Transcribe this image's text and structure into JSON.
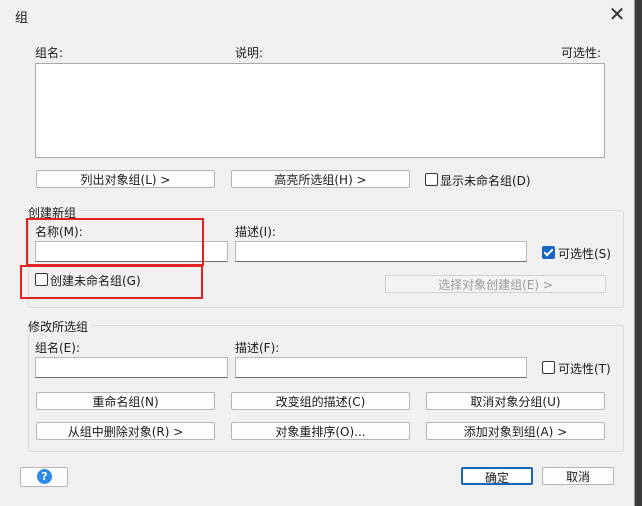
{
  "window": {
    "title": "组",
    "close_glyph": "✕"
  },
  "top": {
    "col_group_name": "组名:",
    "col_description": "说明:",
    "col_selectable": "可选性:",
    "list_button": "列出对象组(L) >",
    "highlight_button": "高亮所选组(H) >",
    "show_unnamed_label": "显示未命名组(D)",
    "show_unnamed_checked": false
  },
  "create_group": {
    "legend": "创建新组",
    "name_label": "名称(M):",
    "name_value": "",
    "desc_label": "描述(I):",
    "desc_value": "",
    "selectable_label": "可选性(S)",
    "selectable_checked": true,
    "unnamed_label": "创建未命名组(G)",
    "unnamed_checked": false,
    "select_objects_button": "选择对象创建组(E) >"
  },
  "modify_group": {
    "legend": "修改所选组",
    "name_label": "组名(E):",
    "name_value": "",
    "desc_label": "描述(F):",
    "desc_value": "",
    "selectable_label": "可选性(T)",
    "selectable_checked": false,
    "rename_button": "重命名组(N)",
    "change_desc_button": "改变组的描述(C)",
    "ungroup_button": "取消对象分组(U)",
    "remove_button": "从组中删除对象(R) >",
    "reorder_button": "对象重排序(O)...",
    "add_button": "添加对象到组(A) >"
  },
  "footer": {
    "help_glyph": "?",
    "ok_button": "确定",
    "cancel_button": "取消"
  },
  "colors": {
    "annotation_red": "#e0231e",
    "accent_blue": "#1665c1"
  }
}
